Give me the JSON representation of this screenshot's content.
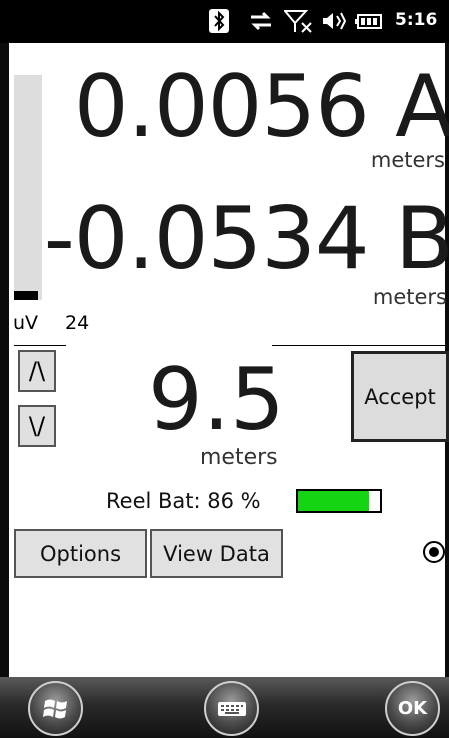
{
  "status_bar": {
    "time": "5:16",
    "icons": [
      "bluetooth-icon",
      "sync-icon",
      "no-signal-icon",
      "volume-icon",
      "battery-icon"
    ]
  },
  "readings": {
    "a_value": "0.0056 A",
    "a_unit": "meters",
    "b_value": "-0.0534 B",
    "b_unit": "meters"
  },
  "signal": {
    "unit": "uV",
    "value": "24",
    "level_fraction": 0.04
  },
  "depth": {
    "up_label": "/\\",
    "down_label": "\\/",
    "value": "9.5",
    "unit": "meters"
  },
  "accept_label": "Accept",
  "reel_battery": {
    "label": "Reel Bat: 86 %",
    "percent": 86,
    "fill_color": "#14d414"
  },
  "buttons": {
    "options_label": "Options",
    "view_data_label": "View Data"
  },
  "softkeys": {
    "ok_label": "OK"
  }
}
